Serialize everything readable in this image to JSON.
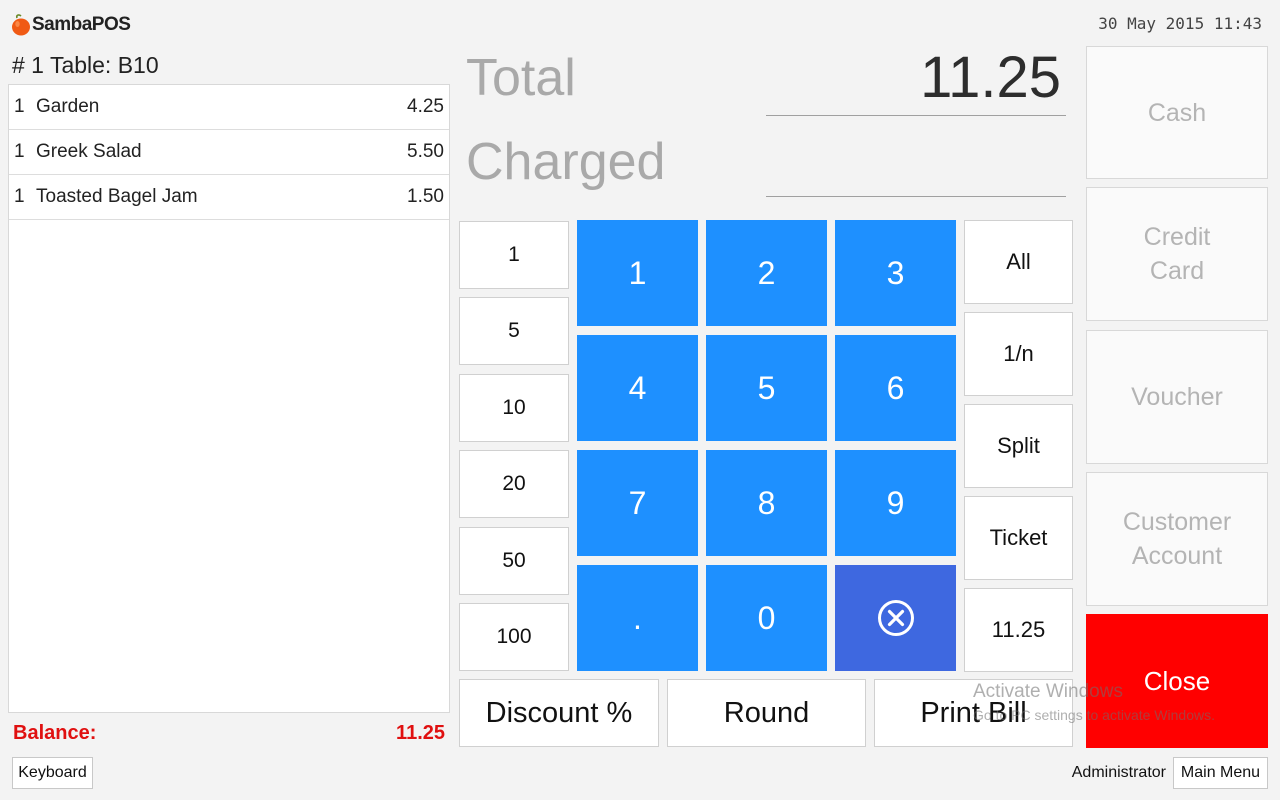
{
  "header": {
    "app_name": "SambaPOS",
    "datetime": "30 May 2015 11:43"
  },
  "ticket": {
    "title": "# 1 Table: B10",
    "orders": [
      {
        "qty": "1",
        "name": "Garden",
        "price": "4.25"
      },
      {
        "qty": "1",
        "name": "Greek Salad",
        "price": "5.50"
      },
      {
        "qty": "1",
        "name": "Toasted Bagel Jam",
        "price": "1.50"
      }
    ],
    "balance_label": "Balance:",
    "balance_value": "11.25"
  },
  "amounts": {
    "total_label": "Total",
    "total_value": "11.25",
    "charged_label": "Charged",
    "charged_value": ""
  },
  "tender_values": [
    "1",
    "5",
    "10",
    "20",
    "50",
    "100"
  ],
  "numpad": [
    "1",
    "2",
    "3",
    "4",
    "5",
    "6",
    "7",
    "8",
    "9",
    ".",
    "0"
  ],
  "functions": [
    "All",
    "1/n",
    "Split",
    "Ticket",
    "11.25"
  ],
  "bottom_buttons": {
    "discount": "Discount %",
    "round": "Round",
    "print_bill": "Print Bill"
  },
  "payment": {
    "cash": "Cash",
    "credit_card": "Credit Card",
    "voucher": "Voucher",
    "customer_account": "Customer Account",
    "close": "Close"
  },
  "footer": {
    "keyboard": "Keyboard",
    "user": "Administrator",
    "main_menu": "Main Menu"
  },
  "watermark": {
    "title": "Activate Windows",
    "subtitle": "Go to PC settings to activate Windows."
  },
  "colors": {
    "numpad_blue": "#1e90ff",
    "clear_blue": "#3e68e0",
    "close_red": "#ff0000",
    "balance_red": "#e01010"
  },
  "icons": {
    "clear": "circle-x-icon",
    "logo": "apple-logo-icon"
  }
}
